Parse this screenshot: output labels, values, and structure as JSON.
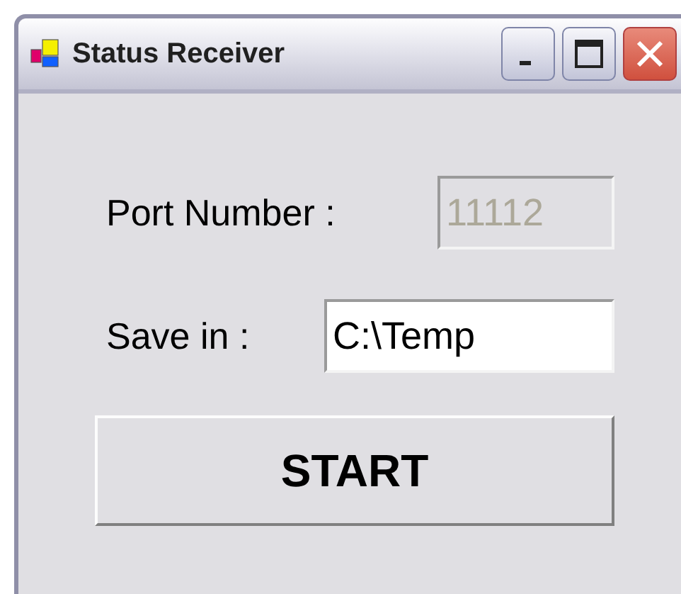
{
  "window": {
    "title": "Status Receiver"
  },
  "title_buttons": [
    {
      "kind": "minimize"
    },
    {
      "kind": "maximize"
    },
    {
      "kind": "close"
    }
  ],
  "fields": [
    {
      "label": "Port Number :",
      "value": "11112",
      "disabled": true
    },
    {
      "label": "Save in :",
      "value": "C:\\Temp",
      "disabled": false
    }
  ],
  "buttons": [
    {
      "label": "START"
    }
  ]
}
